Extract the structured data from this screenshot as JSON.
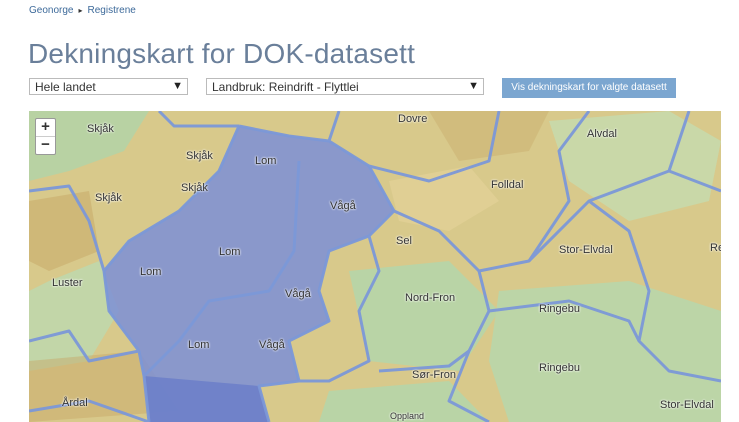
{
  "breadcrumb": {
    "home": "Geonorge",
    "current": "Registrene"
  },
  "page_title": "Dekningskart for DOK-datasett",
  "filters": {
    "area_select": "Hele landet",
    "dataset_select": "Landbruk: Reindrift - Flyttlei",
    "show_button": "Vis dekningskart for valgte datasett"
  },
  "map": {
    "zoom_in": "+",
    "zoom_out": "−",
    "labels": [
      "Skjåk",
      "Skjåk",
      "Skjåk",
      "Skjåk",
      "Lom",
      "Lom",
      "Lom",
      "Lom",
      "Vågå",
      "Vågå",
      "Vågå",
      "Dovre",
      "Folldal",
      "Alvdal",
      "Sel",
      "Nord-Fron",
      "Stor-Elvdal",
      "Ringebu",
      "Ringebu",
      "Luster",
      "Sør-Fron",
      "Årdal",
      "Stor-Elvdal",
      "Oppland",
      "Re"
    ]
  },
  "colors": {
    "coverage_fill": "#7d8fd6",
    "border": "#7c98d8",
    "land": "#d9c98a",
    "forest": "#b9d3a5",
    "title": "#6a7f9a",
    "button": "#7ba6d0"
  }
}
